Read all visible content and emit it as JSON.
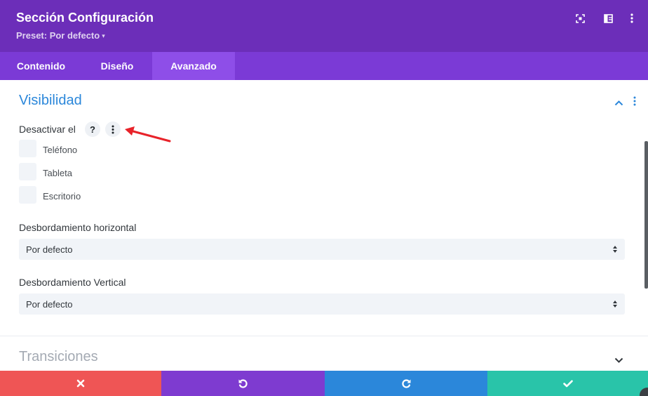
{
  "header": {
    "title": "Sección Configuración",
    "preset": "Preset: Por defecto",
    "icons": [
      "fullscreen-icon",
      "columns-icon",
      "more-vertical-icon"
    ]
  },
  "tabs": [
    {
      "label": "Contenido",
      "active": false
    },
    {
      "label": "Diseño",
      "active": false
    },
    {
      "label": "Avanzado",
      "active": true
    }
  ],
  "visibility": {
    "title": "Visibilidad",
    "disable_label": "Desactivar el",
    "help_glyph": "?",
    "options": [
      {
        "label": "Teléfono",
        "checked": false
      },
      {
        "label": "Tableta",
        "checked": false
      },
      {
        "label": "Escritorio",
        "checked": false
      }
    ],
    "overflow_x": {
      "label": "Desbordamiento horizontal",
      "value": "Por defecto"
    },
    "overflow_y": {
      "label": "Desbordamiento Vertical",
      "value": "Por defecto"
    }
  },
  "transitions": {
    "title": "Transiciones"
  },
  "footer": {
    "buttons": [
      "discard-icon",
      "undo-icon",
      "redo-icon",
      "save-icon"
    ]
  },
  "colors": {
    "header": "#6c2eb9",
    "tabs": "#7b3ad6",
    "tab_active": "#8e4ee8",
    "accent_blue": "#2b87da",
    "discard": "#ef5555",
    "undo": "#7e3bd0",
    "redo": "#2b87da",
    "save": "#29c4a9",
    "annotation_arrow": "#e8232a"
  }
}
